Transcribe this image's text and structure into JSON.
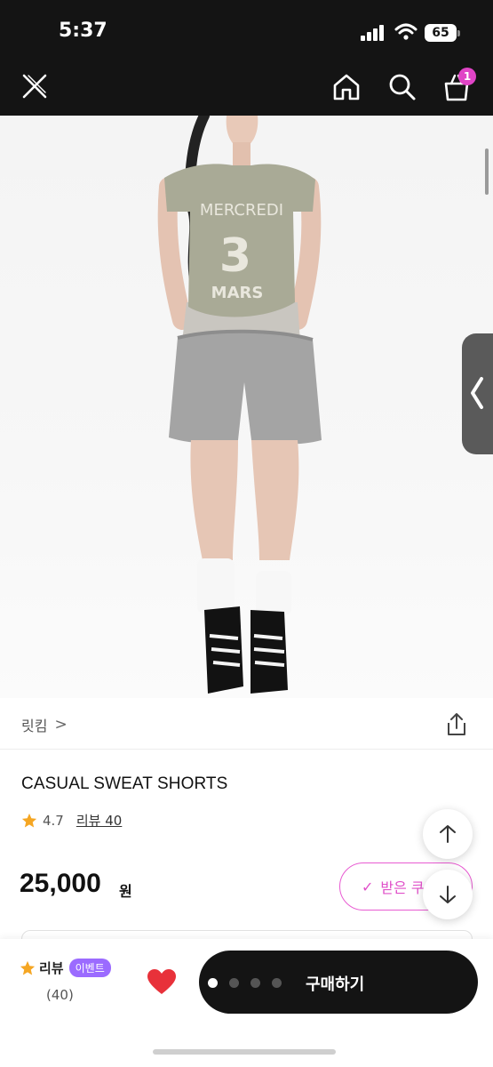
{
  "status_bar": {
    "time": "5:37",
    "battery": "65"
  },
  "header": {
    "cart_count": "1"
  },
  "product": {
    "brand": "릿킴",
    "brand_chevron": ">",
    "name": "CASUAL SWEAT SHORTS",
    "rating": "4.7",
    "review_label": "리뷰 40",
    "price": "25,000",
    "currency": "원",
    "shirt_text": {
      "line1": "MERCREDI",
      "line2": "3",
      "line3": "MARS"
    }
  },
  "coupon": {
    "label": "받은 쿠",
    "check": "✓"
  },
  "bottom_bar": {
    "review_label": "리뷰",
    "event_badge": "이벤트",
    "review_count": "(40)",
    "buy_label": "구매하기"
  },
  "colors": {
    "accent_pink": "#e04fc9",
    "event_purple": "#9b6bff",
    "heart_red": "#e8313a",
    "star_orange": "#f5a623"
  }
}
